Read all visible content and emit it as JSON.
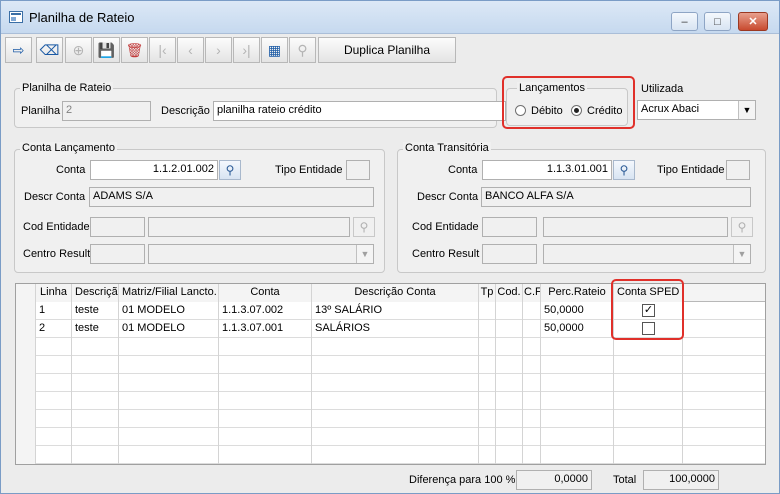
{
  "window": {
    "title": "Planilha de Rateio"
  },
  "toolbar": {
    "duplica_label": "Duplica Planilha"
  },
  "planilha": {
    "group_title": "Planilha de Rateio",
    "planilha_label": "Planilha",
    "planilha_value": "2",
    "descricao_label": "Descrição",
    "descricao_value": "planilha rateio crédito"
  },
  "lancamentos": {
    "group_title": "Lançamentos",
    "debito_label": "Débito",
    "credito_label": "Crédito",
    "selected": "Crédito"
  },
  "utilizada": {
    "label": "Utilizada",
    "value": "Acrux Abaci"
  },
  "conta_lancamento": {
    "group_title": "Conta Lançamento",
    "conta_label": "Conta",
    "conta_value": "1.1.2.01.002",
    "tipo_entidade_label": "Tipo Entidade",
    "descr_conta_label": "Descr Conta",
    "descr_conta_value": "ADAMS S/A",
    "cod_entidade_label": "Cod Entidade",
    "centro_result_label": "Centro Result"
  },
  "conta_transitoria": {
    "group_title": "Conta Transitória",
    "conta_label": "Conta",
    "conta_value": "1.1.3.01.001",
    "tipo_entidade_label": "Tipo Entidade",
    "descr_conta_label": "Descr Conta",
    "descr_conta_value": "BANCO ALFA S/A",
    "cod_entidade_label": "Cod Entidade",
    "centro_result_label": "Centro Result"
  },
  "grid": {
    "headers": [
      "Linha",
      "Descriçã",
      "Matriz/Filial Lancto.",
      "Conta",
      "Descrição Conta",
      "Tp",
      "Cod.",
      "C.F",
      "Perc.Rateio",
      "Conta SPED"
    ],
    "rows": [
      {
        "linha": "1",
        "descricao": "teste",
        "matriz": "01 MODELO",
        "conta": "1.1.3.07.002",
        "descricao_conta": "13º SALÁRIO",
        "perc": "50,0000",
        "sped": true
      },
      {
        "linha": "2",
        "descricao": "teste",
        "matriz": "01 MODELO",
        "conta": "1.1.3.07.001",
        "descricao_conta": "SALÁRIOS",
        "perc": "50,0000",
        "sped": false
      }
    ]
  },
  "footer": {
    "diferenca_label": "Diferença para 100 %",
    "diferenca_value": "0,0000",
    "total_label": "Total",
    "total_value": "100,0000"
  },
  "colors": {
    "highlight": "#e0302a",
    "accent": "#1b5aa5"
  }
}
